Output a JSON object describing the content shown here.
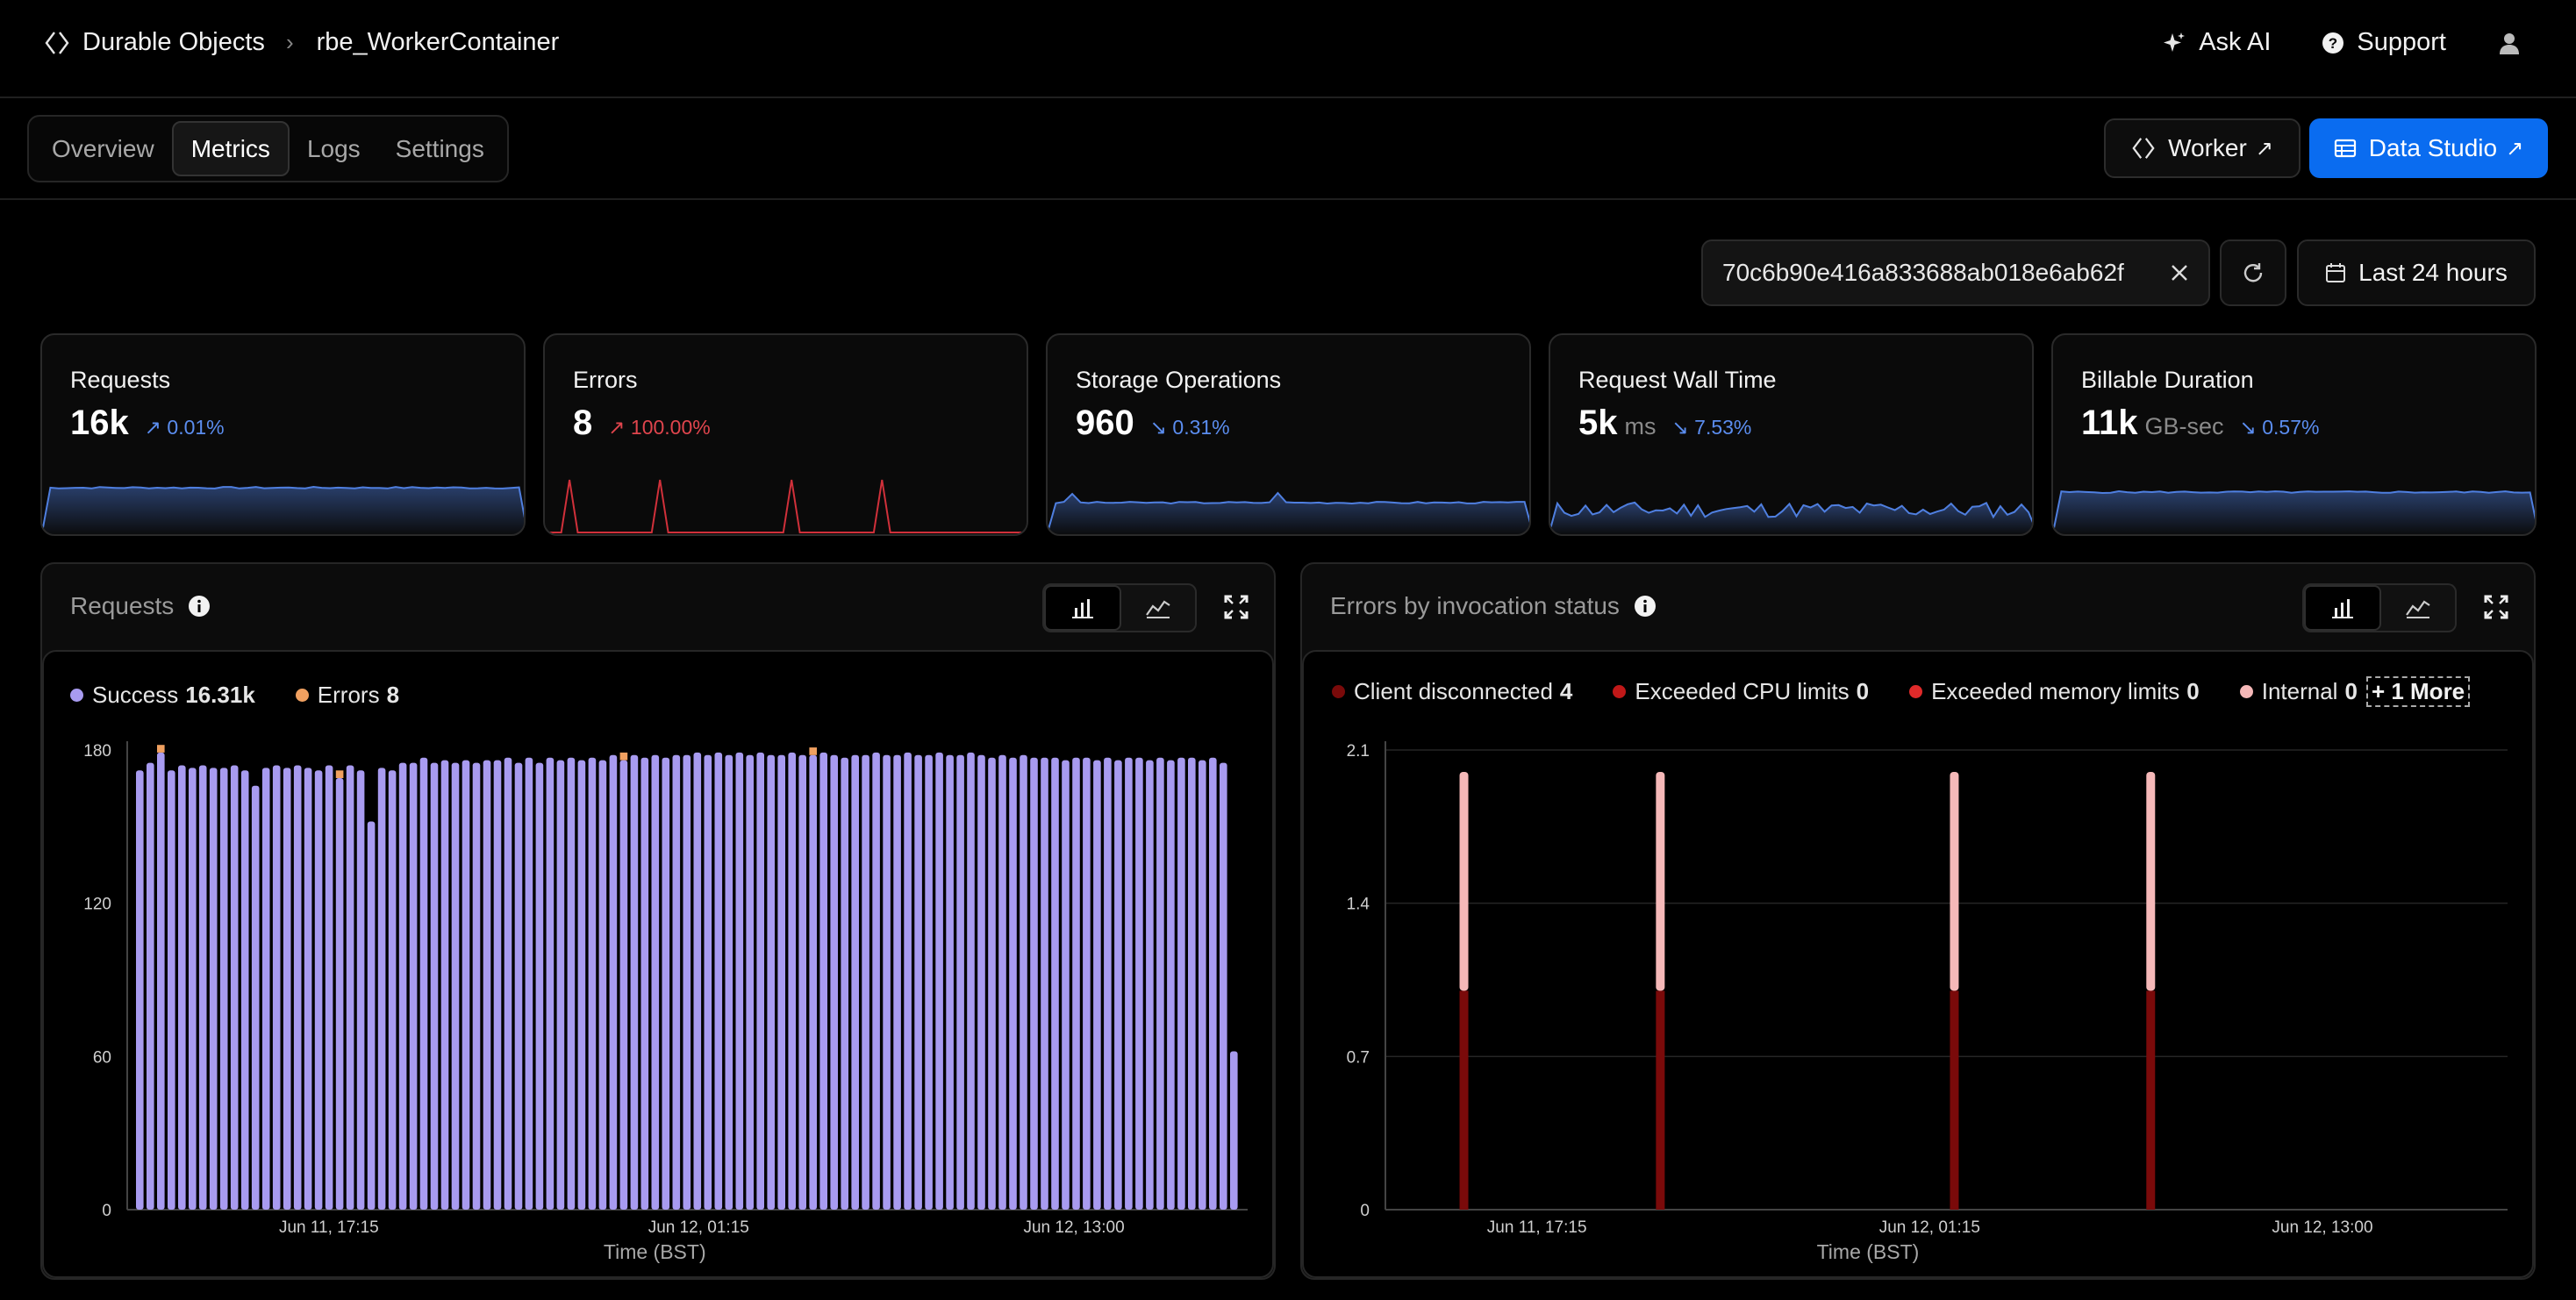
{
  "header": {
    "breadcrumb_root": "Durable Objects",
    "breadcrumb_current": "rbe_WorkerContainer",
    "ask_ai": "Ask AI",
    "support": "Support"
  },
  "tabs": [
    {
      "label": "Overview",
      "active": false
    },
    {
      "label": "Metrics",
      "active": true
    },
    {
      "label": "Logs",
      "active": false
    },
    {
      "label": "Settings",
      "active": false
    }
  ],
  "actions": {
    "worker_label": "Worker",
    "studio_label": "Data Studio"
  },
  "filters": {
    "object_id": "70c6b90e416a833688ab018e6ab62f",
    "time_range": "Last 24 hours"
  },
  "stats": [
    {
      "title": "Requests",
      "value": "16k",
      "unit": "",
      "delta": "0.01%",
      "trend": "up",
      "color": "blue"
    },
    {
      "title": "Errors",
      "value": "8",
      "unit": "",
      "delta": "100.00%",
      "trend": "up",
      "color": "red"
    },
    {
      "title": "Storage Operations",
      "value": "960",
      "unit": "",
      "delta": "0.31%",
      "trend": "down",
      "color": "blue"
    },
    {
      "title": "Request Wall Time",
      "value": "5k",
      "unit": "ms",
      "delta": "7.53%",
      "trend": "down",
      "color": "blue"
    },
    {
      "title": "Billable Duration",
      "value": "11k",
      "unit": "GB-sec",
      "delta": "0.57%",
      "trend": "down",
      "color": "blue"
    }
  ],
  "colors": {
    "success": "#a89bf0",
    "errors_series": "#f0a060",
    "client_disconnected": "#7a0a0a",
    "exceeded_cpu": "#c01818",
    "exceeded_memory": "#e02a2a",
    "internal": "#f5b8b8",
    "spark_blue": "#4f7fe0",
    "spark_red": "#d0303a",
    "primary_button": "#0a6cf0"
  },
  "panels": {
    "requests": {
      "title": "Requests",
      "legend": [
        {
          "name": "Success",
          "value": "16.31k"
        },
        {
          "name": "Errors",
          "value": "8"
        }
      ]
    },
    "errors": {
      "title": "Errors by invocation status",
      "legend": [
        {
          "name": "Client disconnected",
          "value": "4"
        },
        {
          "name": "Exceeded CPU limits",
          "value": "0"
        },
        {
          "name": "Exceeded memory limits",
          "value": "0"
        },
        {
          "name": "Internal",
          "value": "0"
        }
      ],
      "more_label": "+ 1 More"
    }
  },
  "chart_data": [
    {
      "type": "bar",
      "stacked": true,
      "xlabel": "Time (BST)",
      "x_ticks": [
        "Jun 11, 17:15",
        "Jun 12, 01:15",
        "Jun 12, 13:00"
      ],
      "y_ticks": [
        0,
        60,
        120,
        180
      ],
      "ylim": [
        0,
        180
      ],
      "grid": false,
      "legend_position": "top-left",
      "series": [
        {
          "name": "Success",
          "values": [
            172,
            175,
            179,
            172,
            174,
            173,
            174,
            173,
            173,
            174,
            172,
            166,
            173,
            174,
            173,
            174,
            173,
            172,
            174,
            169,
            174,
            172,
            152,
            173,
            172,
            175,
            175,
            177,
            175,
            176,
            175,
            176,
            175,
            176,
            176,
            177,
            175,
            177,
            175,
            177,
            176,
            177,
            176,
            177,
            176,
            178,
            176,
            178,
            177,
            178,
            177,
            178,
            178,
            179,
            178,
            179,
            178,
            179,
            178,
            179,
            178,
            178,
            179,
            178,
            178,
            179,
            178,
            177,
            178,
            178,
            179,
            178,
            178,
            179,
            178,
            178,
            179,
            178,
            178,
            179,
            178,
            177,
            178,
            177,
            178,
            177,
            177,
            177,
            176,
            177,
            177,
            176,
            177,
            176,
            177,
            177,
            176,
            177,
            176,
            177,
            177,
            176,
            177,
            175,
            62
          ]
        },
        {
          "name": "Errors",
          "values": [
            0,
            0,
            2,
            0,
            0,
            0,
            0,
            0,
            0,
            0,
            0,
            0,
            0,
            0,
            0,
            0,
            0,
            0,
            0,
            2,
            0,
            0,
            0,
            0,
            0,
            0,
            0,
            0,
            0,
            0,
            0,
            0,
            0,
            0,
            0,
            0,
            0,
            0,
            0,
            0,
            0,
            0,
            0,
            0,
            0,
            0,
            2,
            0,
            0,
            0,
            0,
            0,
            0,
            0,
            0,
            0,
            0,
            0,
            0,
            0,
            0,
            0,
            0,
            0,
            2,
            0,
            0,
            0,
            0,
            0,
            0,
            0,
            0,
            0,
            0,
            0,
            0,
            0,
            0,
            0,
            0,
            0,
            0,
            0,
            0,
            0,
            0,
            0,
            0,
            0,
            0,
            0,
            0,
            0,
            0,
            0,
            0,
            0,
            0,
            0,
            0,
            0,
            0,
            0,
            0
          ]
        }
      ]
    },
    {
      "type": "bar",
      "stacked": true,
      "xlabel": "Time (BST)",
      "x_ticks": [
        "Jun 11, 17:15",
        "Jun 12, 01:15",
        "Jun 12, 13:00"
      ],
      "y_ticks": [
        0,
        0.7,
        1.4,
        2.1
      ],
      "ylim": [
        0,
        2.1
      ],
      "grid": true,
      "legend_position": "top-left",
      "bar_positions_fraction": [
        0.07,
        0.245,
        0.507,
        0.682
      ],
      "series": [
        {
          "name": "Client disconnected",
          "values": [
            1,
            1,
            1,
            1
          ]
        },
        {
          "name": "Internal",
          "values": [
            1,
            1,
            1,
            1
          ]
        }
      ]
    }
  ]
}
